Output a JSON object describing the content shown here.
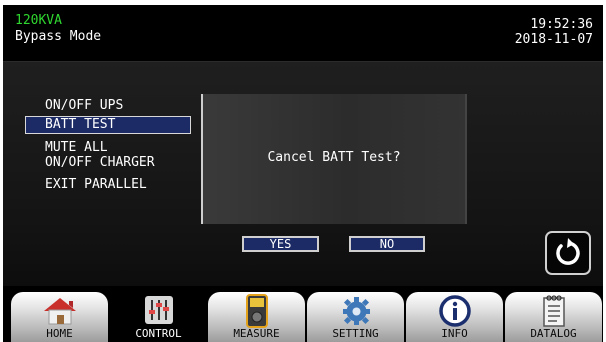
{
  "header": {
    "model": "120KVA",
    "mode": "Bypass Mode",
    "time": "19:52:36",
    "date": "2018-11-07"
  },
  "control_menu": {
    "items": [
      {
        "label": "ON/OFF UPS"
      },
      {
        "label": "BATT TEST",
        "selected": true
      },
      {
        "label": "MUTE ALL"
      },
      {
        "label": "ON/OFF CHARGER"
      },
      {
        "label": "EXIT PARALLEL"
      }
    ]
  },
  "dialog": {
    "message": "Cancel BATT Test?",
    "yes_label": "YES",
    "no_label": "NO"
  },
  "back_button": {
    "icon": "refresh-back-icon"
  },
  "nav": {
    "tabs": [
      {
        "label": "HOME",
        "icon": "home-icon"
      },
      {
        "label": "CONTROL",
        "icon": "sliders-icon",
        "active": true
      },
      {
        "label": "MEASURE",
        "icon": "meter-icon"
      },
      {
        "label": "SETTING",
        "icon": "gear-icon"
      },
      {
        "label": "INFO",
        "icon": "info-icon"
      },
      {
        "label": "DATALOG",
        "icon": "log-icon"
      }
    ]
  },
  "colors": {
    "model_text": "#2fd62f",
    "selected_bg": "#1c2b66",
    "background": "#000000"
  }
}
